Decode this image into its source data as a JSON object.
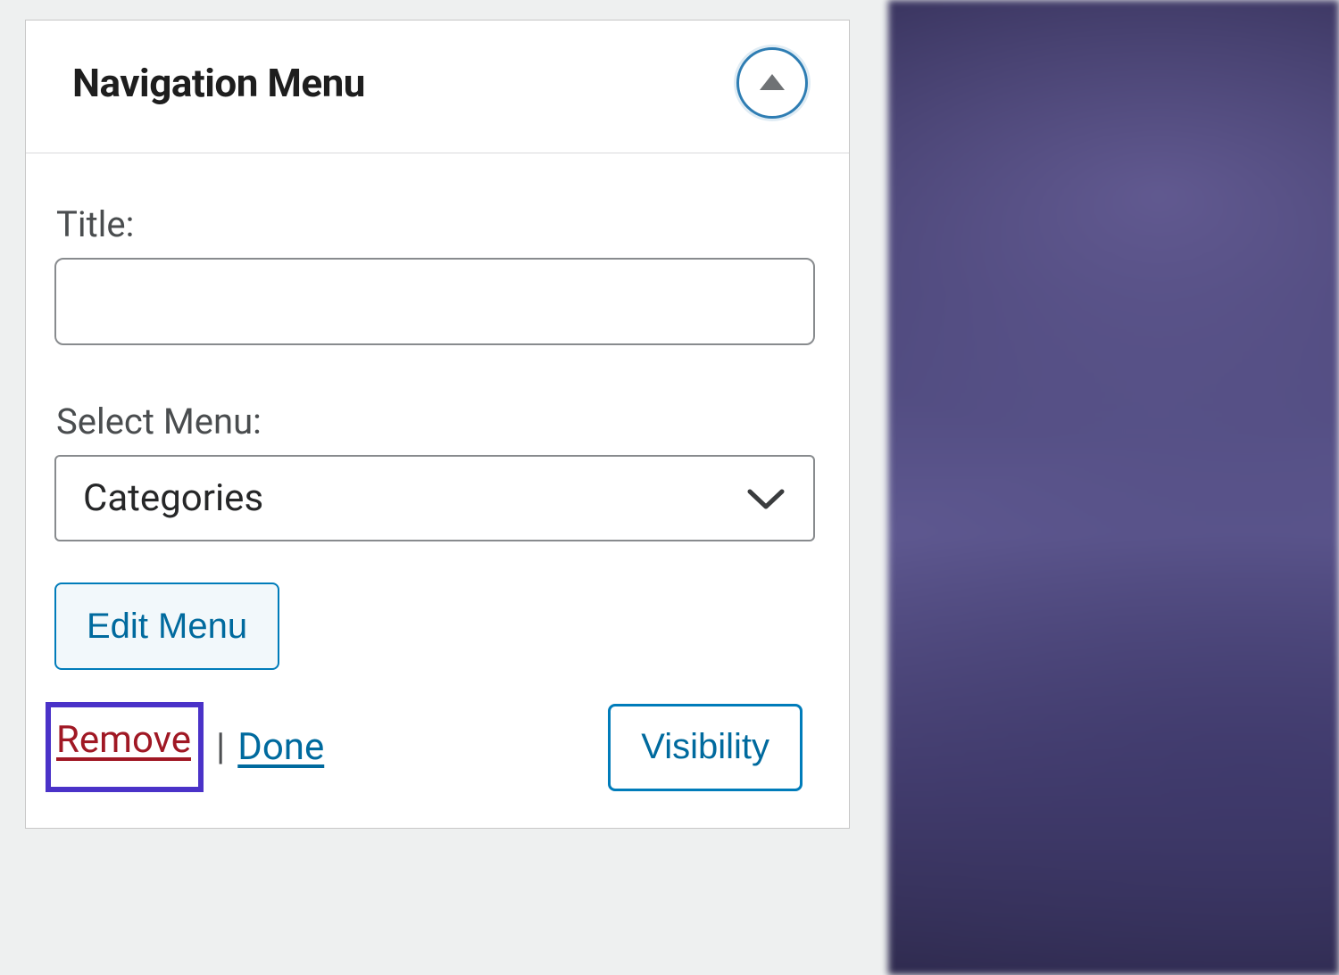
{
  "widget": {
    "title": "Navigation Menu",
    "fields": {
      "title_label": "Title:",
      "title_value": "",
      "select_label": "Select Menu:",
      "select_value": "Categories"
    },
    "buttons": {
      "edit_menu": "Edit Menu",
      "visibility": "Visibility"
    },
    "links": {
      "remove": "Remove",
      "done": "Done",
      "separator": "|"
    },
    "colors": {
      "accent": "#007cba",
      "danger": "#a01824",
      "highlight": "#4a32c8"
    }
  }
}
